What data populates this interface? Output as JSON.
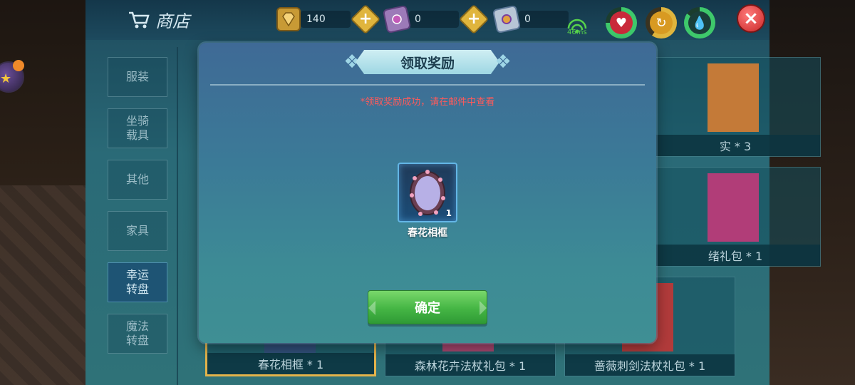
{
  "header": {
    "shop_title": "商店",
    "currencies": [
      {
        "name": "diamond",
        "value": "140"
      },
      {
        "name": "gem-card",
        "value": "0"
      },
      {
        "name": "flower-card",
        "value": "0"
      }
    ],
    "ping": "46ms"
  },
  "categories": [
    {
      "label": "服装",
      "active": false
    },
    {
      "label": "坐骑\n载具",
      "active": false
    },
    {
      "label": "其他",
      "active": false
    },
    {
      "label": "家具",
      "active": false
    },
    {
      "label": "幸运\n转盘",
      "active": true
    },
    {
      "label": "魔法\n转盘",
      "active": false
    }
  ],
  "cards": [
    {
      "label": "实 * 3"
    },
    {
      "label": "绪礼包 * 1"
    },
    {
      "label": "春花相框 * 1",
      "selected": true
    },
    {
      "label": "森林花卉法杖礼包 * 1"
    },
    {
      "label": "蔷薇刺剑法杖礼包 * 1"
    }
  ],
  "modal": {
    "title": "领取奖励",
    "notice": "*领取奖励成功，请在邮件中查看",
    "reward": {
      "name": "春花相框",
      "quantity": "1"
    },
    "confirm_label": "确定"
  },
  "colors": {
    "notice": "#ff5a5a",
    "confirm": "#44b544",
    "selected_border": "#e3b34b"
  }
}
